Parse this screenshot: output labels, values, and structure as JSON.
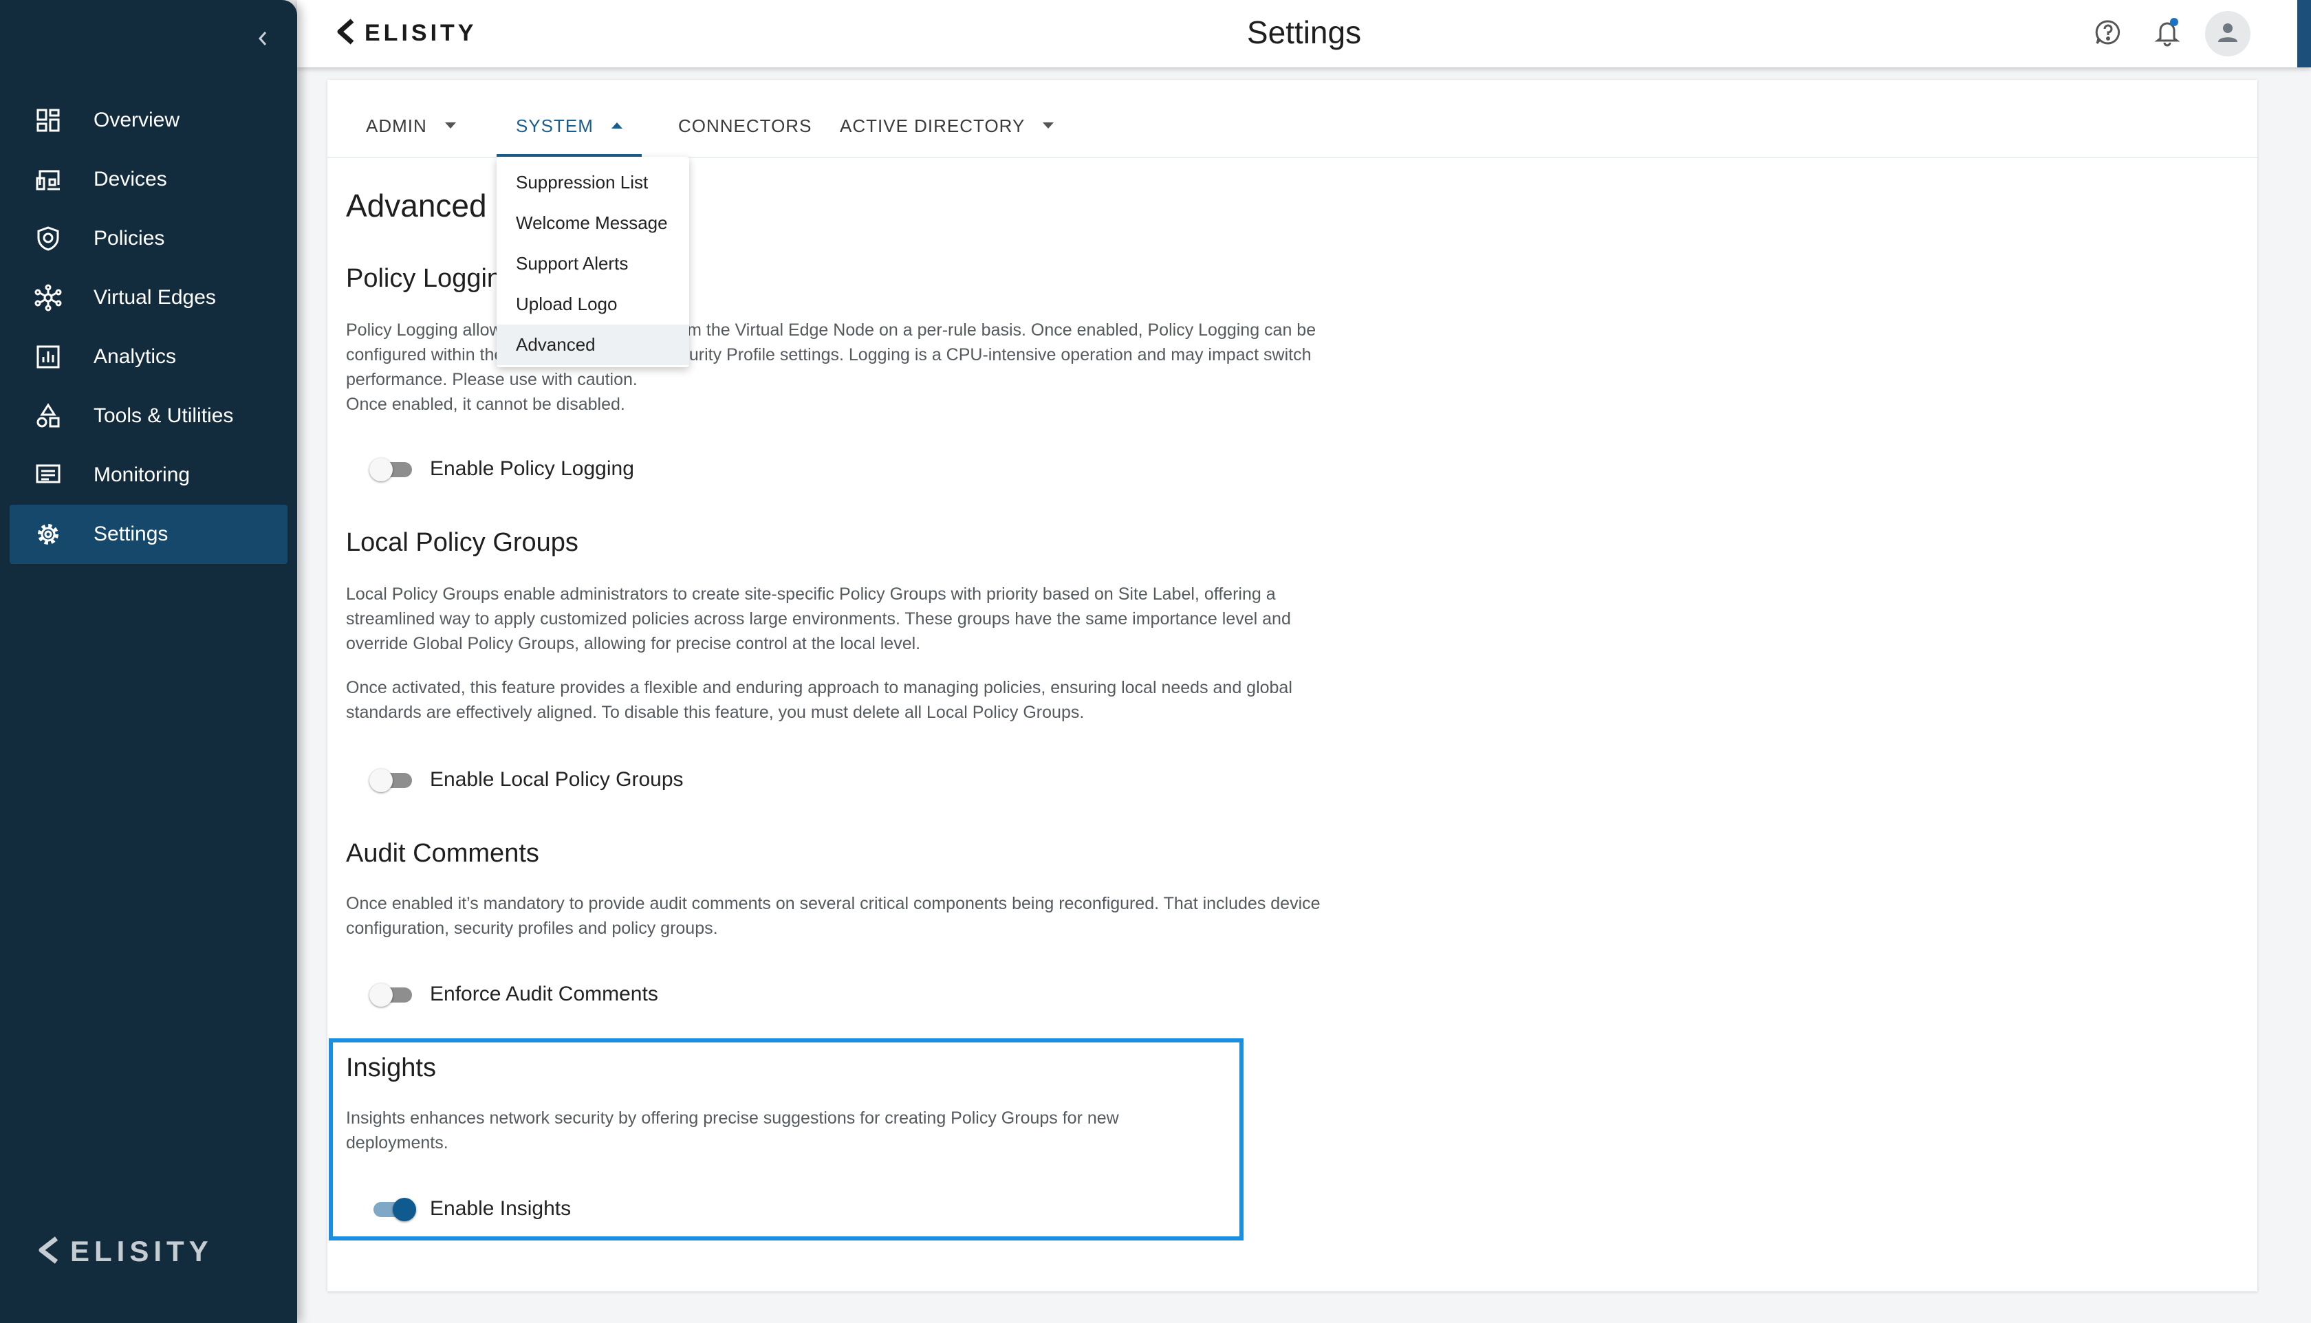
{
  "app": {
    "brand": "ELISITY"
  },
  "header": {
    "title": "Settings",
    "help_icon": "help-icon",
    "bell_icon": "bell-icon",
    "notification_dot_color": "#1d72c4",
    "avatar_icon": "user-icon"
  },
  "sidebar": {
    "collapse_icon": "chevron-left-icon",
    "items": [
      {
        "label": "Overview",
        "icon": "dashboard-icon",
        "active": false
      },
      {
        "label": "Devices",
        "icon": "devices-icon",
        "active": false
      },
      {
        "label": "Policies",
        "icon": "shield-icon",
        "active": false
      },
      {
        "label": "Virtual Edges",
        "icon": "network-icon",
        "active": false
      },
      {
        "label": "Analytics",
        "icon": "analytics-icon",
        "active": false
      },
      {
        "label": "Tools & Utilities",
        "icon": "tools-icon",
        "active": false
      },
      {
        "label": "Monitoring",
        "icon": "monitor-icon",
        "active": false
      },
      {
        "label": "Settings",
        "icon": "gear-icon",
        "active": true
      }
    ],
    "footer_brand": "ELISITY"
  },
  "tabs": [
    {
      "label": "ADMIN",
      "has_caret": true,
      "active": false
    },
    {
      "label": "SYSTEM",
      "has_caret": true,
      "active": true
    },
    {
      "label": "CONNECTORS",
      "has_caret": false,
      "active": false
    },
    {
      "label": "ACTIVE DIRECTORY",
      "has_caret": true,
      "active": false
    }
  ],
  "dropdown": {
    "items": [
      "Suppression List",
      "Welcome Message",
      "Support Alerts",
      "Upload Logo",
      "Advanced"
    ],
    "selected": "Advanced"
  },
  "page": {
    "heading": "Advanced",
    "sections": [
      {
        "title": "Policy Logging",
        "paragraphs": [
          "Policy Logging allows logs to be collected from the Virtual Edge Node on a per-rule basis. Once enabled, Policy Logging can be configured within the Security Policy and Security Profile settings. Logging is a CPU-intensive operation and may impact switch performance. Please use with caution.",
          "Once enabled, it cannot be disabled."
        ],
        "toggle_label": "Enable Policy Logging",
        "toggle_on": false
      },
      {
        "title": "Local Policy Groups",
        "paragraphs": [
          "Local Policy Groups enable administrators to create site-specific Policy Groups with priority based on Site Label, offering a streamlined way to apply customized policies across large environments. These groups have the same importance level and override Global Policy Groups, allowing for precise control at the local level.",
          "Once activated, this feature provides a flexible and enduring approach to managing policies, ensuring local needs and global standards are effectively aligned. To disable this feature, you must delete all Local Policy Groups."
        ],
        "toggle_label": "Enable Local Policy Groups",
        "toggle_on": false
      },
      {
        "title": "Audit Comments",
        "paragraphs": [
          "Once enabled it’s mandatory to provide audit comments on several critical components being reconfigured. That includes device configuration, security profiles and policy groups."
        ],
        "toggle_label": "Enforce Audit Comments",
        "toggle_on": false
      },
      {
        "title": "Insights",
        "paragraphs": [
          "Insights enhances network security by offering precise suggestions for creating Policy Groups for new deployments."
        ],
        "toggle_label": "Enable Insights",
        "toggle_on": true
      }
    ]
  },
  "colors": {
    "sidebar_bg": "#132c3d",
    "sidebar_active": "#15486a",
    "accent": "#1d5d8c",
    "highlight_border": "#1a8fe0"
  }
}
